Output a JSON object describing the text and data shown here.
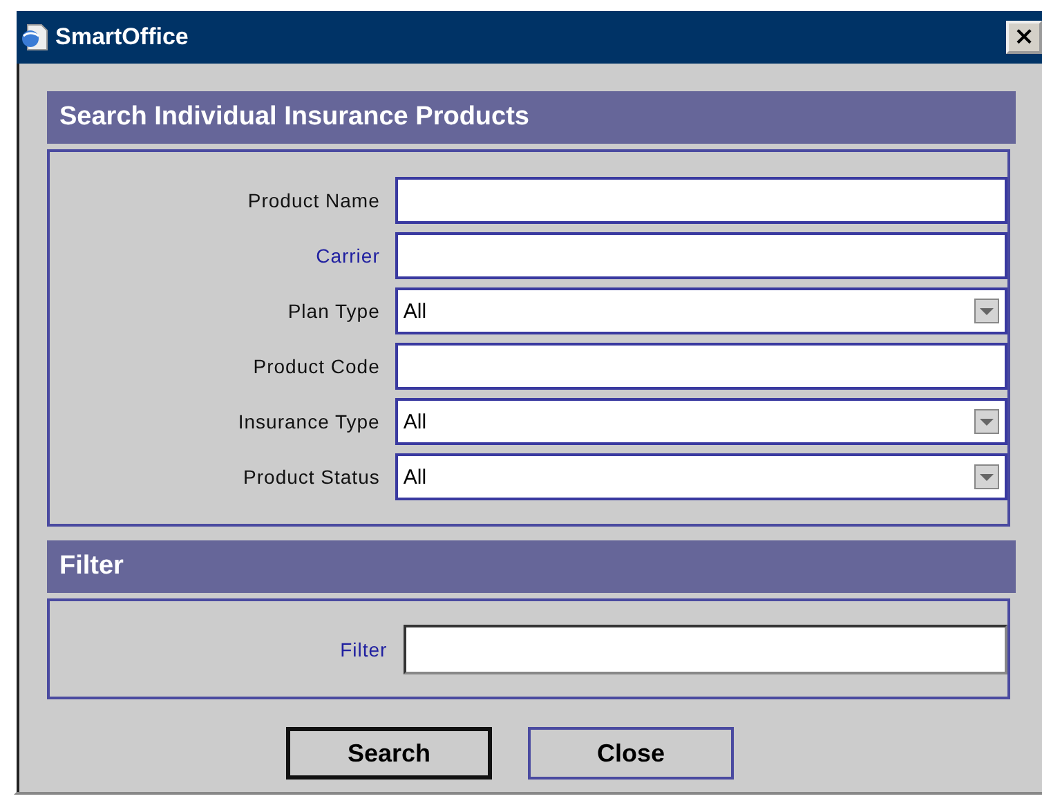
{
  "window": {
    "title": "SmartOffice",
    "close": "×"
  },
  "search_section": {
    "title": "Search Individual Insurance Products",
    "fields": [
      {
        "label": "Product Name",
        "kind": "text",
        "link": false
      },
      {
        "label": "Carrier",
        "kind": "text",
        "link": true
      },
      {
        "label": "Plan Type",
        "kind": "select",
        "value": "All",
        "link": false
      },
      {
        "label": "Product Code",
        "kind": "text",
        "link": false
      },
      {
        "label": "Insurance Type",
        "kind": "select",
        "value": "All",
        "link": false
      },
      {
        "label": "Product Status",
        "kind": "select",
        "value": "All",
        "link": false
      }
    ]
  },
  "filter_section": {
    "title": "Filter",
    "fields": [
      {
        "label": "Filter",
        "kind": "sunken",
        "link": true
      }
    ]
  },
  "buttons": [
    {
      "label": "Search",
      "default": true
    },
    {
      "label": "Close",
      "default": false
    }
  ]
}
